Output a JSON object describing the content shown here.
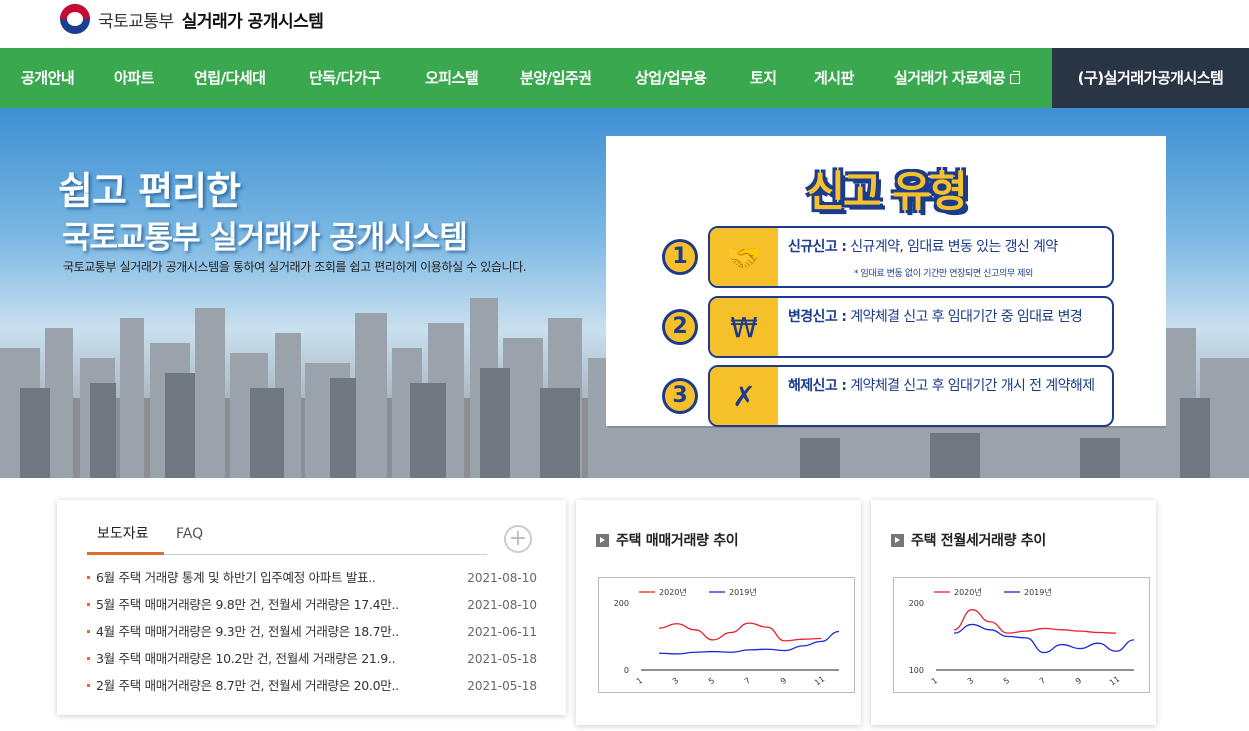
{
  "header": {
    "ministry": "국토교통부",
    "system_name": "실거래가 공개시스템"
  },
  "nav": {
    "items": [
      "공개안내",
      "아파트",
      "연립/다세대",
      "단독/다가구",
      "오피스텔",
      "분양/입주권",
      "상업/업무용",
      "토지",
      "게시판",
      "실거래가 자료제공"
    ],
    "external_icon": "external-link-icon",
    "legacy_link": "(구)실거래가공개시스템"
  },
  "hero": {
    "title_line1": "쉽고 편리한",
    "title_line2": "국토교통부 실거래가 공개시스템",
    "description": "국토교통부 실거래가 공개시스템을 통하여 실거래가 조회를 쉽고 편리하게 이용하실 수 있습니다."
  },
  "report_types": {
    "title": "신고 유형",
    "items": [
      {
        "num": "1",
        "icon": "handshake-icon",
        "name": "신규신고 :",
        "desc": "신규계약, 임대료 변동 있는 갱신 계약",
        "note": "* 임대료 변동 없이 기간만 연장되면 신고의무 제외"
      },
      {
        "num": "2",
        "icon": "money-bag-icon",
        "name": "변경신고 :",
        "desc": "계약체결 신고 후 임대기간 중 임대료 변경",
        "note": ""
      },
      {
        "num": "3",
        "icon": "cancel-document-icon",
        "name": "해제신고 :",
        "desc": "계약체결 신고 후 임대기간 개시 전 계약해제",
        "note": ""
      }
    ]
  },
  "news": {
    "tabs": [
      "보도자료",
      "FAQ"
    ],
    "more_icon": "plus-icon",
    "items": [
      {
        "title": "6월 주택 거래량 통계 및 하반기 입주예정 아파트 발표..",
        "date": "2021-08-10"
      },
      {
        "title": "5월 주택 매매거래량은 9.8만 건, 전월세 거래량은 17.4만..",
        "date": "2021-08-10"
      },
      {
        "title": "4월 주택 매매거래량은 9.3만 건, 전월세 거래량은 18.7만..",
        "date": "2021-06-11"
      },
      {
        "title": "3월 주택 매매거래량은 10.2만 건, 전월세 거래량은 21.9..",
        "date": "2021-05-18"
      },
      {
        "title": "2월 주택 매매거래량은 8.7만 건, 전월세 거래량은 20.0만..",
        "date": "2021-05-18"
      }
    ]
  },
  "charts": {
    "sale_title": "주택 매매거래량 추이",
    "rent_title": "주택 전월세거래량 추이"
  },
  "colors": {
    "nav_green": "#3aa84f",
    "nav_dark": "#293445",
    "accent_orange": "#e06b2c",
    "series_2020": "#e8212e",
    "series_2019": "#1a2ad6"
  },
  "chart_data": [
    {
      "type": "line",
      "title": "주택 매매거래량 추이",
      "x": [
        1,
        2,
        3,
        4,
        5,
        6,
        7,
        8,
        9,
        10,
        11,
        12
      ],
      "xticks": [
        "1",
        "3",
        "5",
        "7",
        "9",
        "11"
      ],
      "ylim": [
        0,
        200
      ],
      "yticks": [
        "200",
        "0"
      ],
      "legend": "top",
      "series": [
        {
          "name": "2020년",
          "color": "#e8212e",
          "values": [
            null,
            125,
            138,
            120,
            90,
            112,
            140,
            128,
            87,
            92,
            94,
            null
          ]
        },
        {
          "name": "2019년",
          "color": "#1a2ad6",
          "values": [
            null,
            50,
            48,
            53,
            55,
            53,
            60,
            62,
            58,
            72,
            85,
            115
          ]
        }
      ]
    },
    {
      "type": "line",
      "title": "주택 전월세거래량 추이",
      "x": [
        1,
        2,
        3,
        4,
        5,
        6,
        7,
        8,
        9,
        10,
        11,
        12
      ],
      "xticks": [
        "1",
        "3",
        "5",
        "7",
        "9",
        "11"
      ],
      "ylim": [
        100,
        200
      ],
      "yticks": [
        "200",
        "100"
      ],
      "legend": "top",
      "series": [
        {
          "name": "2020년",
          "color": "#e8212e",
          "values": [
            null,
            160,
            190,
            172,
            155,
            158,
            162,
            160,
            158,
            156,
            155,
            null
          ]
        },
        {
          "name": "2019년",
          "color": "#1a2ad6",
          "values": [
            null,
            155,
            168,
            160,
            150,
            148,
            126,
            138,
            132,
            140,
            128,
            145
          ]
        }
      ]
    }
  ]
}
